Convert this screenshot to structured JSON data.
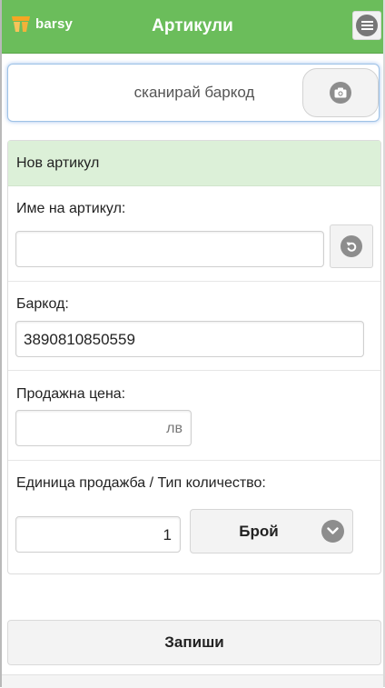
{
  "header": {
    "logo_text": "barsy",
    "title": "Артикули",
    "brand_color": "#6bbd5b"
  },
  "scan": {
    "prompt": "сканирай баркод",
    "icon": "camera-icon"
  },
  "form": {
    "section_title": "Нов артикул",
    "name": {
      "label": "Име на артикул:",
      "value": "",
      "reset_icon": "undo-icon"
    },
    "barcode": {
      "label": "Баркод:",
      "value": "3890810850559"
    },
    "price": {
      "label": "Продажна цена:",
      "value": "",
      "unit": "лв"
    },
    "sale_unit": {
      "label": "Единица продажба / Тип количество:",
      "quantity": "1",
      "selected_type": "Брой",
      "dropdown_icon": "chevron-down-icon"
    }
  },
  "actions": {
    "save_label": "Запиши"
  }
}
